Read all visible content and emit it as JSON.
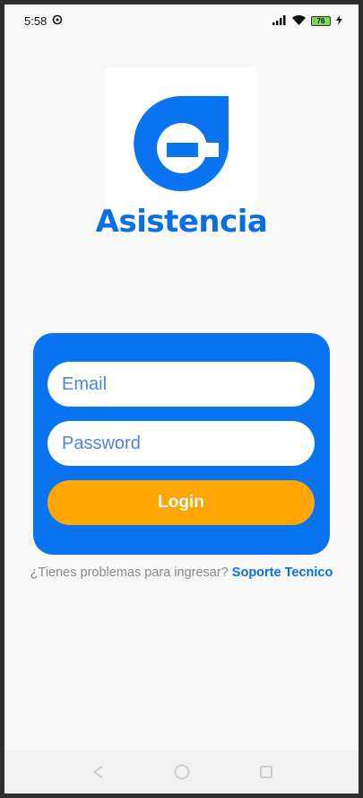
{
  "status_bar": {
    "time": "5:58",
    "battery_level": "76",
    "icons": [
      "sync-icon",
      "signal-icon",
      "wifi-icon",
      "battery-icon",
      "charging-icon"
    ]
  },
  "brand": {
    "name": "Asistencia",
    "logo_icon": "g-logo-icon",
    "color": "#0a6fe0"
  },
  "login_form": {
    "email_placeholder": "Email",
    "password_placeholder": "Password",
    "login_label": "Login",
    "card_color": "#0a74f0",
    "button_color": "#ffa500"
  },
  "help": {
    "text": "¿Tienes problemas para ingresar?",
    "link_label": "Soporte Tecnico"
  },
  "nav_bar": {
    "icons": [
      "back-icon",
      "home-icon",
      "recents-icon"
    ]
  }
}
